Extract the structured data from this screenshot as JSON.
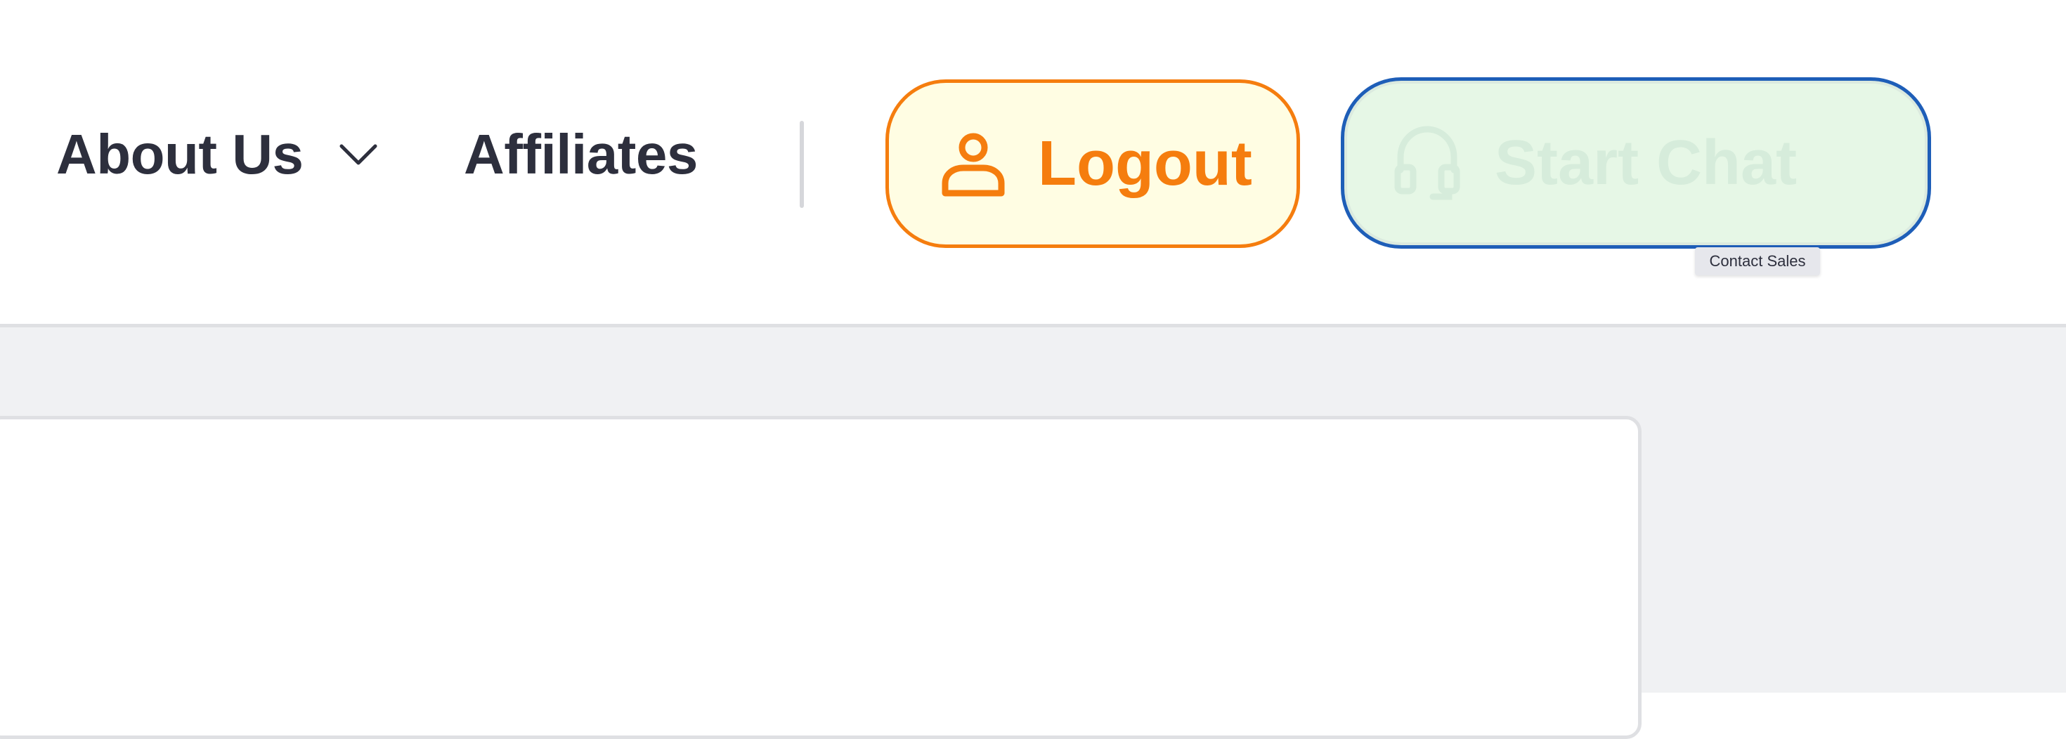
{
  "nav": {
    "about": {
      "label": "About Us",
      "icon": "chevron-down-icon"
    },
    "affiliates": {
      "label": "Affiliates"
    }
  },
  "actions": {
    "logout": {
      "label": "Logout",
      "icon": "user-icon",
      "color": "#f57d0e",
      "background": "#fffde3"
    },
    "chat": {
      "label": "Start Chat",
      "icon": "headset-icon",
      "border_color": "#1e5eb8",
      "background": "#e6f7e6"
    }
  },
  "tooltip": {
    "text": "Contact Sales"
  },
  "colors": {
    "nav_text": "#2d2f3d",
    "divider": "#d6d7db",
    "content_background": "#f0f1f3"
  }
}
